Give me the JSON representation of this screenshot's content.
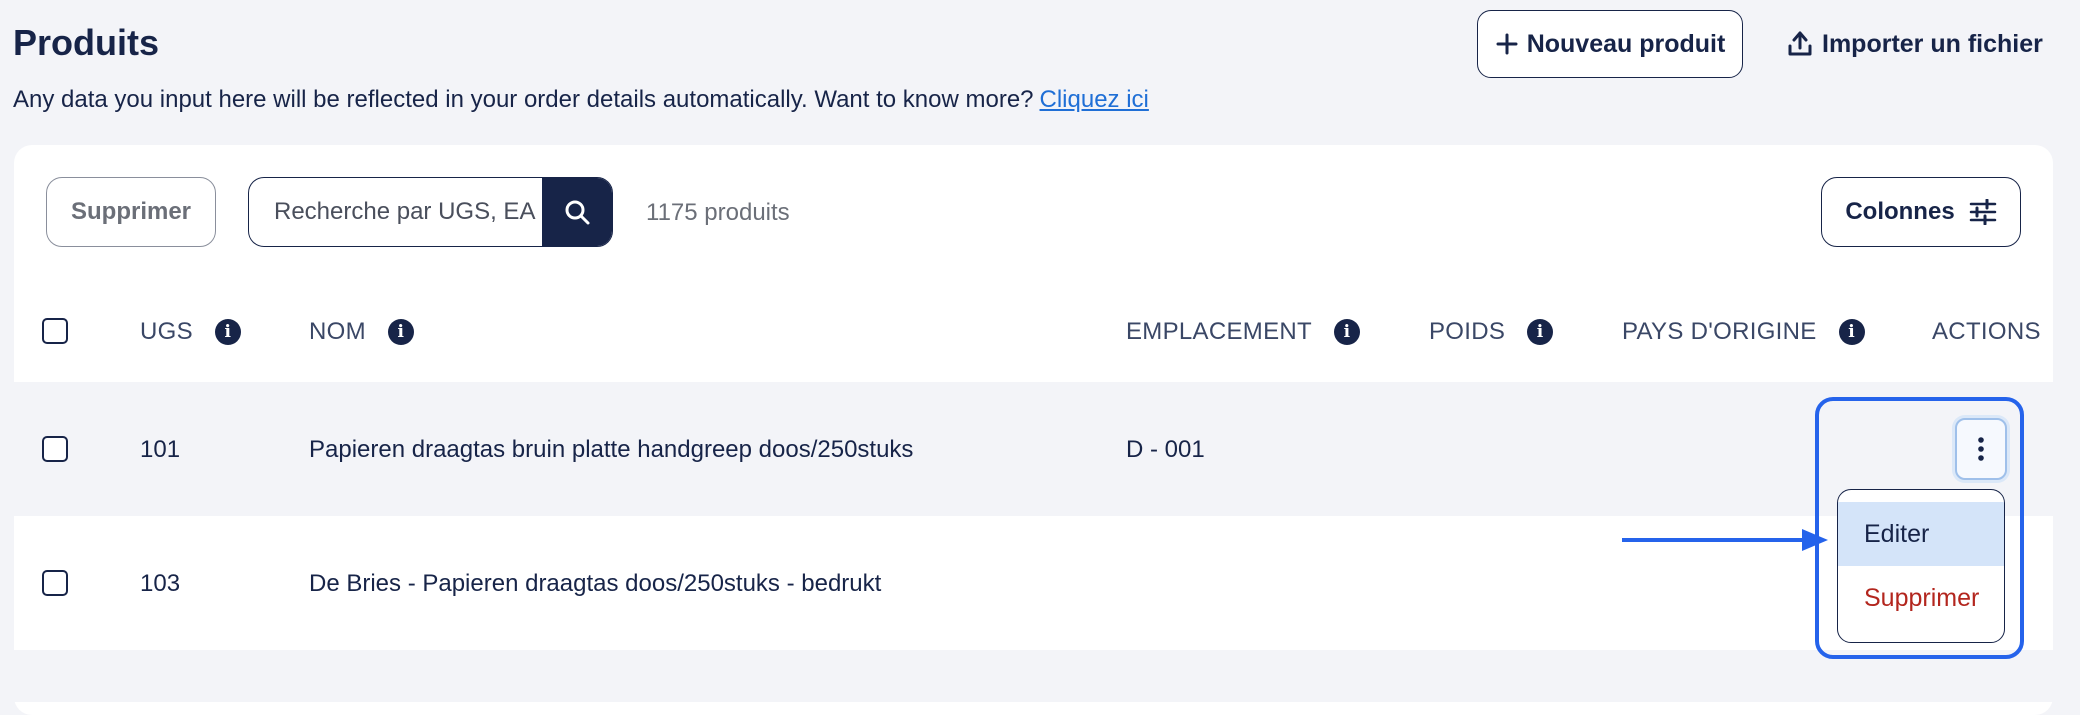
{
  "header": {
    "title": "Produits",
    "subtitle": "Any data you input here will be reflected in your order details automatically. Want to know more?",
    "subtitle_link": "Cliquez ici",
    "new_product_label": "Nouveau produit",
    "import_label": "Importer un fichier"
  },
  "toolbar": {
    "delete_label": "Supprimer",
    "search_placeholder": "Recherche par UGS, EA",
    "count_label": "1175 produits",
    "columns_label": "Colonnes"
  },
  "table": {
    "columns": [
      "UGS",
      "NOM",
      "EMPLACEMENT",
      "POIDS",
      "PAYS D'ORIGINE",
      "ACTIONS"
    ],
    "rows": [
      {
        "ugs": "101",
        "nom": "Papieren draagtas bruin platte handgreep doos/250stuks",
        "emplacement": "D - 001",
        "poids": "",
        "pays": ""
      },
      {
        "ugs": "103",
        "nom": "De Bries - Papieren draagtas doos/250stuks - bedrukt",
        "emplacement": "",
        "poids": "",
        "pays": ""
      }
    ]
  },
  "action_menu": {
    "edit_label": "Editer",
    "delete_label": "Supprimer"
  },
  "colors": {
    "primary": "#172448",
    "highlight": "#2563eb",
    "danger": "#b3261e",
    "row_alt": "#f3f4f8"
  },
  "icons": [
    "plus-icon",
    "upload-icon",
    "search-icon",
    "sliders-icon",
    "info-icon",
    "kebab-icon",
    "arrow-right-icon"
  ]
}
